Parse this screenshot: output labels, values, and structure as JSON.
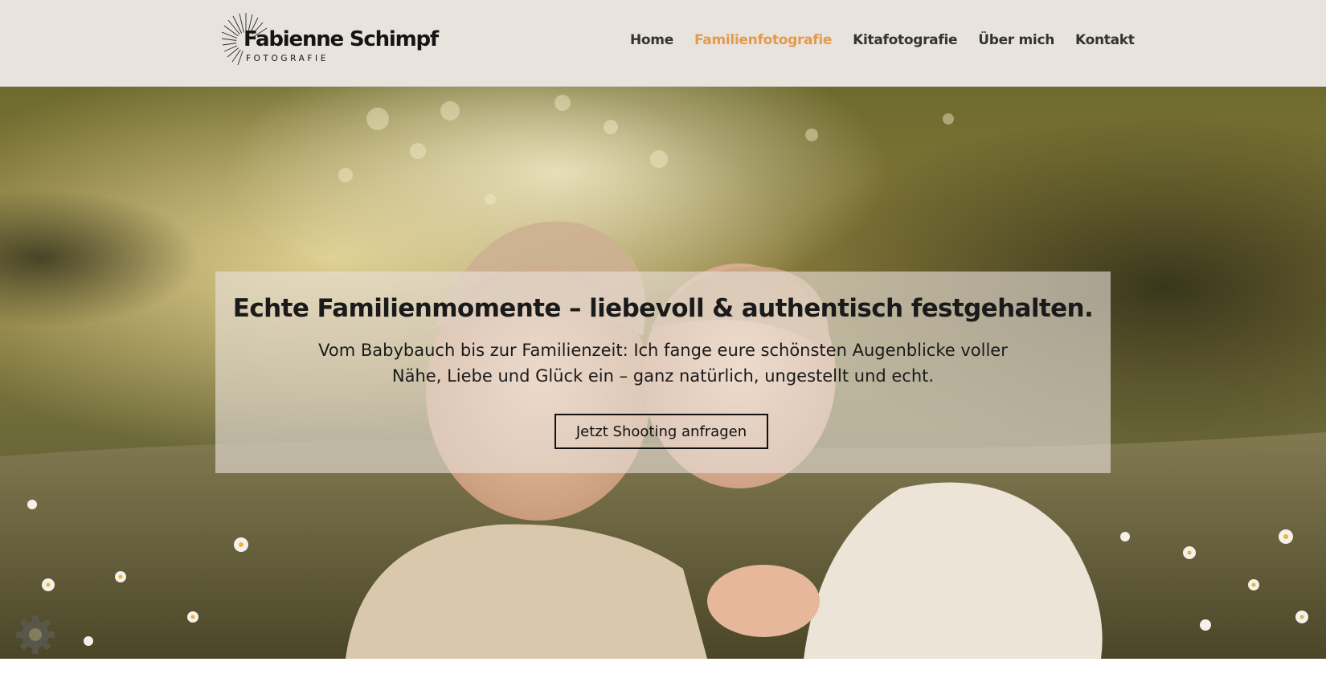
{
  "brand": {
    "name": "Fabienne Schimpf",
    "subtitle": "FOTOGRAFIE",
    "accent_color": "#e39a4c",
    "header_bg": "#e8e3dd"
  },
  "nav": {
    "items": [
      {
        "label": "Home",
        "active": false
      },
      {
        "label": "Familienfotografie",
        "active": true
      },
      {
        "label": "Kitafotografie",
        "active": false
      },
      {
        "label": "Über mich",
        "active": false
      },
      {
        "label": "Kontakt",
        "active": false
      }
    ]
  },
  "hero": {
    "image_alt": "Zwei lachende Kinder liegen in einer Gänseblümchenwiese",
    "headline": "Echte Familienmomente – liebevoll & authentisch festgehalten.",
    "subline_line1": "Vom Babybauch bis zur Familienzeit: Ich fange eure schönsten Augenblicke voller",
    "subline_line2": "Nähe, Liebe und Glück ein – ganz natürlich, ungestellt und echt.",
    "cta_label": "Jetzt Shooting anfragen"
  },
  "icons": {
    "logo": "sunburst-logo-icon",
    "cookie_settings": "gear-icon"
  }
}
